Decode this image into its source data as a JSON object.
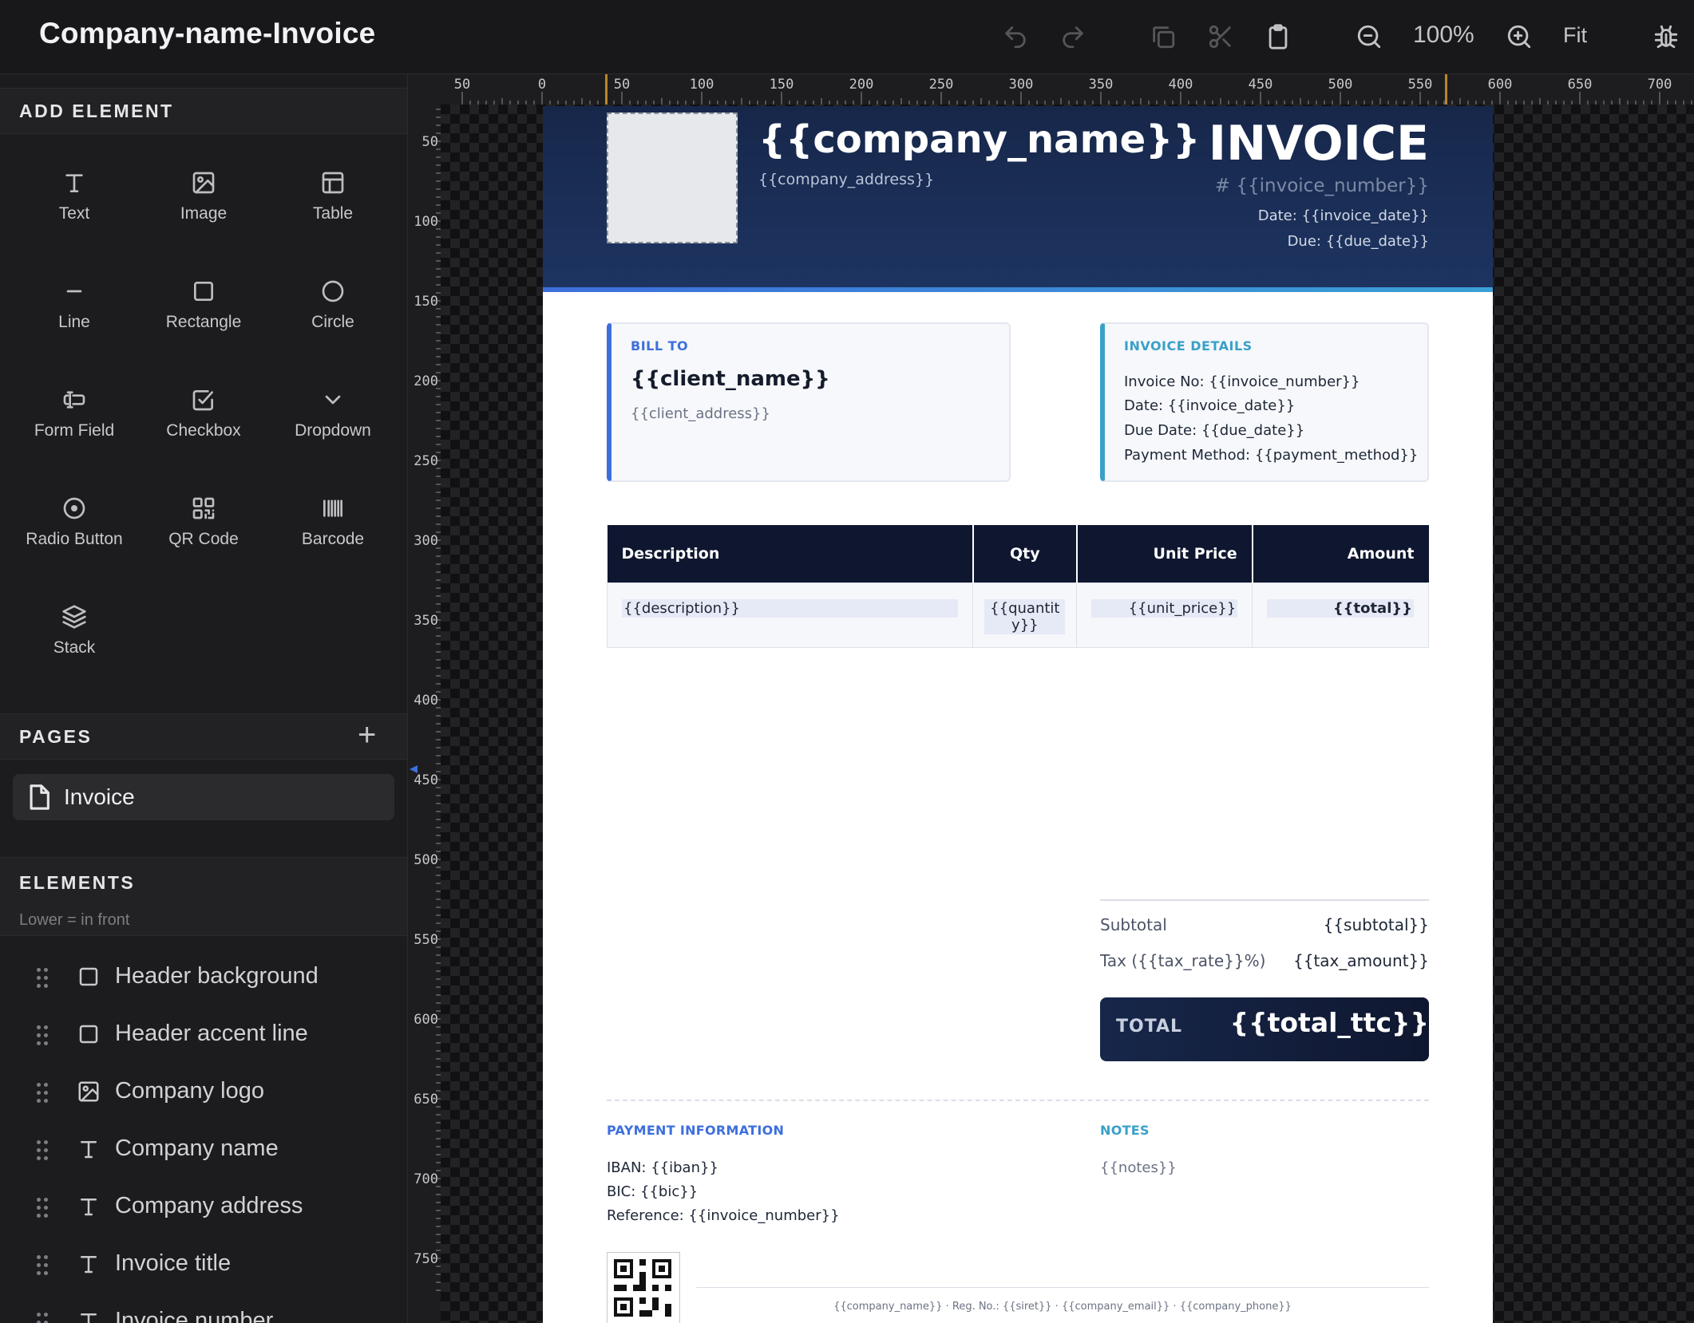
{
  "app": {
    "title": "Company-name-Invoice",
    "zoom": "100%",
    "fit_label": "Fit"
  },
  "toolbar_icons": [
    "undo-icon",
    "redo-icon",
    "duplicate-icon",
    "cut-icon",
    "clipboard-icon",
    "zoom-out-icon",
    "zoom-in-icon",
    "debug-icon"
  ],
  "add_element": {
    "title": "ADD ELEMENT",
    "tools": [
      {
        "label": "Text",
        "icon": "text-icon"
      },
      {
        "label": "Image",
        "icon": "image-icon"
      },
      {
        "label": "Table",
        "icon": "table-icon"
      },
      {
        "label": "Line",
        "icon": "line-icon"
      },
      {
        "label": "Rectangle",
        "icon": "rectangle-icon"
      },
      {
        "label": "Circle",
        "icon": "circle-icon"
      },
      {
        "label": "Form Field",
        "icon": "form-field-icon"
      },
      {
        "label": "Checkbox",
        "icon": "checkbox-icon"
      },
      {
        "label": "Dropdown",
        "icon": "dropdown-icon"
      },
      {
        "label": "Radio Button",
        "icon": "radio-icon"
      },
      {
        "label": "QR Code",
        "icon": "qr-icon"
      },
      {
        "label": "Barcode",
        "icon": "barcode-icon"
      },
      {
        "label": "Stack",
        "icon": "stack-icon"
      }
    ]
  },
  "pages": {
    "title": "PAGES",
    "add": "+",
    "items": [
      {
        "label": "Invoice"
      }
    ]
  },
  "elements": {
    "title": "ELEMENTS",
    "subtitle": "Lower = in front",
    "items": [
      {
        "label": "Header background",
        "icon": "rectangle-icon"
      },
      {
        "label": "Header accent line",
        "icon": "rectangle-icon"
      },
      {
        "label": "Company logo",
        "icon": "image-icon"
      },
      {
        "label": "Company name",
        "icon": "text-icon"
      },
      {
        "label": "Company address",
        "icon": "text-icon"
      },
      {
        "label": "Invoice title",
        "icon": "text-icon"
      },
      {
        "label": "Invoice number",
        "icon": "text-icon"
      }
    ]
  },
  "rulers": {
    "top": [
      "50",
      "0",
      "50",
      "100",
      "150",
      "200",
      "250",
      "300",
      "350",
      "400",
      "450",
      "500",
      "550",
      "600",
      "650",
      "700"
    ],
    "left": [
      "50",
      "100",
      "150",
      "200",
      "250",
      "300",
      "350",
      "400",
      "450",
      "500",
      "550",
      "600",
      "650",
      "700",
      "750"
    ]
  },
  "document": {
    "company_name": "{{company_name}}",
    "company_address": "{{company_address}}",
    "title": "INVOICE",
    "number": "# {{invoice_number}}",
    "date": "Date: {{invoice_date}}",
    "due": "Due: {{due_date}}",
    "bill_to": {
      "label": "BILL TO",
      "name": "{{client_name}}",
      "address": "{{client_address}}"
    },
    "details": {
      "label": "INVOICE DETAILS",
      "lines": [
        "Invoice No: {{invoice_number}}",
        "Date: {{invoice_date}}",
        "Due Date: {{due_date}}",
        "Payment Method: {{payment_method}}"
      ]
    },
    "table": {
      "headers": [
        "Description",
        "Qty",
        "Unit Price",
        "Amount"
      ],
      "row": [
        "{{description}}",
        "{{quantity}}",
        "{{unit_price}}",
        "{{total}}"
      ]
    },
    "subtotal": {
      "label": "Subtotal",
      "value": "{{subtotal}}"
    },
    "tax": {
      "label": "Tax ({{tax_rate}}%)",
      "value": "{{tax_amount}}"
    },
    "total": {
      "label": "TOTAL",
      "value": "{{total_ttc}}"
    },
    "payment": {
      "label": "PAYMENT INFORMATION",
      "lines": [
        "IBAN: {{iban}}",
        "BIC: {{bic}}",
        "Reference: {{invoice_number}}"
      ]
    },
    "notes": {
      "label": "NOTES",
      "value": "{{notes}}"
    },
    "footer": "{{company_name}}  ·  Reg. No.: {{siret}}  ·  {{company_email}}  ·  {{company_phone}}"
  }
}
